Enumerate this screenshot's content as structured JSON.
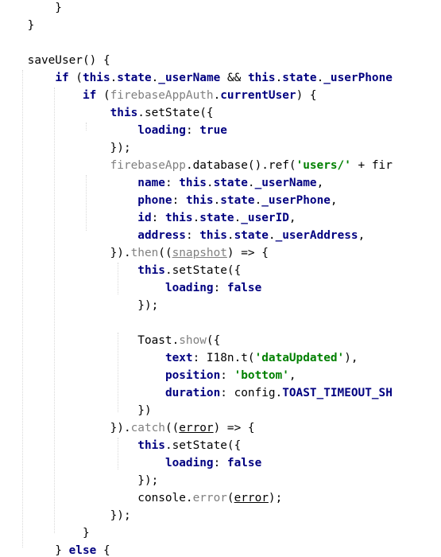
{
  "editor": {
    "language": "javascript",
    "colors": {
      "background": "#ffffff",
      "keyword": "#000080",
      "string": "#008000",
      "property": "#660e7a",
      "unused": "#808080",
      "text": "#000000",
      "indent_guide": "#d8d8d8"
    },
    "lines": [
      [
        {
          "t": "pl",
          "v": "        }"
        }
      ],
      [
        {
          "t": "pl",
          "v": "    }"
        }
      ],
      [
        {
          "t": "pl",
          "v": ""
        }
      ],
      [
        {
          "t": "fn",
          "v": "    saveUser"
        },
        {
          "t": "pl",
          "v": "() {"
        }
      ],
      [
        {
          "t": "pl",
          "v": "        "
        },
        {
          "t": "kw",
          "v": "if"
        },
        {
          "t": "pl",
          "v": " ("
        },
        {
          "t": "kw",
          "v": "this"
        },
        {
          "t": "pl",
          "v": "."
        },
        {
          "t": "kw",
          "v": "state"
        },
        {
          "t": "pl",
          "v": "."
        },
        {
          "t": "kw",
          "v": "_userName"
        },
        {
          "t": "pl",
          "v": " && "
        },
        {
          "t": "kw",
          "v": "this"
        },
        {
          "t": "pl",
          "v": "."
        },
        {
          "t": "kw",
          "v": "state"
        },
        {
          "t": "pl",
          "v": "."
        },
        {
          "t": "kw",
          "v": "_userPhone"
        }
      ],
      [
        {
          "t": "pl",
          "v": "            "
        },
        {
          "t": "kw",
          "v": "if"
        },
        {
          "t": "pl",
          "v": " ("
        },
        {
          "t": "dim",
          "v": "firebaseAppAuth"
        },
        {
          "t": "pl",
          "v": "."
        },
        {
          "t": "kw",
          "v": "currentUser"
        },
        {
          "t": "pl",
          "v": ") {"
        }
      ],
      [
        {
          "t": "pl",
          "v": "                "
        },
        {
          "t": "kw",
          "v": "this"
        },
        {
          "t": "pl",
          "v": ".setState({"
        }
      ],
      [
        {
          "t": "pl",
          "v": "                    "
        },
        {
          "t": "kw",
          "v": "loading"
        },
        {
          "t": "pl",
          "v": ": "
        },
        {
          "t": "kw",
          "v": "true"
        }
      ],
      [
        {
          "t": "pl",
          "v": "                });"
        }
      ],
      [
        {
          "t": "pl",
          "v": "                "
        },
        {
          "t": "dim",
          "v": "firebaseApp"
        },
        {
          "t": "pl",
          "v": ".database().ref("
        },
        {
          "t": "str",
          "v": "'users/'"
        },
        {
          "t": "pl",
          "v": " + fir"
        }
      ],
      [
        {
          "t": "pl",
          "v": "                    "
        },
        {
          "t": "kw",
          "v": "name"
        },
        {
          "t": "pl",
          "v": ": "
        },
        {
          "t": "kw",
          "v": "this"
        },
        {
          "t": "pl",
          "v": "."
        },
        {
          "t": "kw",
          "v": "state"
        },
        {
          "t": "pl",
          "v": "."
        },
        {
          "t": "kw",
          "v": "_userName"
        },
        {
          "t": "pl",
          "v": ","
        }
      ],
      [
        {
          "t": "pl",
          "v": "                    "
        },
        {
          "t": "kw",
          "v": "phone"
        },
        {
          "t": "pl",
          "v": ": "
        },
        {
          "t": "kw",
          "v": "this"
        },
        {
          "t": "pl",
          "v": "."
        },
        {
          "t": "kw",
          "v": "state"
        },
        {
          "t": "pl",
          "v": "."
        },
        {
          "t": "kw",
          "v": "_userPhone"
        },
        {
          "t": "pl",
          "v": ","
        }
      ],
      [
        {
          "t": "pl",
          "v": "                    "
        },
        {
          "t": "kw",
          "v": "id"
        },
        {
          "t": "pl",
          "v": ": "
        },
        {
          "t": "kw",
          "v": "this"
        },
        {
          "t": "pl",
          "v": "."
        },
        {
          "t": "kw",
          "v": "state"
        },
        {
          "t": "pl",
          "v": "."
        },
        {
          "t": "kw",
          "v": "_userID"
        },
        {
          "t": "pl",
          "v": ","
        }
      ],
      [
        {
          "t": "pl",
          "v": "                    "
        },
        {
          "t": "kw",
          "v": "address"
        },
        {
          "t": "pl",
          "v": ": "
        },
        {
          "t": "kw",
          "v": "this"
        },
        {
          "t": "pl",
          "v": "."
        },
        {
          "t": "kw",
          "v": "state"
        },
        {
          "t": "pl",
          "v": "."
        },
        {
          "t": "kw",
          "v": "_userAddress"
        },
        {
          "t": "pl",
          "v": ","
        }
      ],
      [
        {
          "t": "pl",
          "v": "                })."
        },
        {
          "t": "dim",
          "v": "then"
        },
        {
          "t": "pl",
          "v": "(("
        },
        {
          "t": "dim ul",
          "v": "snapshot"
        },
        {
          "t": "pl",
          "v": ") => {"
        }
      ],
      [
        {
          "t": "pl",
          "v": "                    "
        },
        {
          "t": "kw",
          "v": "this"
        },
        {
          "t": "pl",
          "v": ".setState({"
        }
      ],
      [
        {
          "t": "pl",
          "v": "                        "
        },
        {
          "t": "kw",
          "v": "loading"
        },
        {
          "t": "pl",
          "v": ": "
        },
        {
          "t": "kw",
          "v": "false"
        }
      ],
      [
        {
          "t": "pl",
          "v": "                    });"
        }
      ],
      [
        {
          "t": "pl",
          "v": ""
        }
      ],
      [
        {
          "t": "pl",
          "v": "                    Toast."
        },
        {
          "t": "dim",
          "v": "show"
        },
        {
          "t": "pl",
          "v": "({"
        }
      ],
      [
        {
          "t": "pl",
          "v": "                        "
        },
        {
          "t": "kw",
          "v": "text"
        },
        {
          "t": "pl",
          "v": ": I18n.t("
        },
        {
          "t": "str",
          "v": "'dataUpdated'"
        },
        {
          "t": "pl",
          "v": "),"
        }
      ],
      [
        {
          "t": "pl",
          "v": "                        "
        },
        {
          "t": "kw",
          "v": "position"
        },
        {
          "t": "pl",
          "v": ": "
        },
        {
          "t": "str",
          "v": "'bottom'"
        },
        {
          "t": "pl",
          "v": ","
        }
      ],
      [
        {
          "t": "pl",
          "v": "                        "
        },
        {
          "t": "kw",
          "v": "duration"
        },
        {
          "t": "pl",
          "v": ": config."
        },
        {
          "t": "kw",
          "v": "TOAST_TIMEOUT_SH"
        }
      ],
      [
        {
          "t": "pl",
          "v": "                    })"
        }
      ],
      [
        {
          "t": "pl",
          "v": "                })."
        },
        {
          "t": "dim",
          "v": "catch"
        },
        {
          "t": "pl",
          "v": "(("
        },
        {
          "t": "pl ul",
          "v": "error"
        },
        {
          "t": "pl",
          "v": ") => {"
        }
      ],
      [
        {
          "t": "pl",
          "v": "                    "
        },
        {
          "t": "kw",
          "v": "this"
        },
        {
          "t": "pl",
          "v": ".setState({"
        }
      ],
      [
        {
          "t": "pl",
          "v": "                        "
        },
        {
          "t": "kw",
          "v": "loading"
        },
        {
          "t": "pl",
          "v": ": "
        },
        {
          "t": "kw",
          "v": "false"
        }
      ],
      [
        {
          "t": "pl",
          "v": "                    });"
        }
      ],
      [
        {
          "t": "pl",
          "v": "                    console."
        },
        {
          "t": "dim",
          "v": "error"
        },
        {
          "t": "pl",
          "v": "("
        },
        {
          "t": "pl ul",
          "v": "error"
        },
        {
          "t": "pl",
          "v": ");"
        }
      ],
      [
        {
          "t": "pl",
          "v": "                });"
        }
      ],
      [
        {
          "t": "pl",
          "v": "            }"
        }
      ],
      [
        {
          "t": "pl",
          "v": "        } "
        },
        {
          "t": "kw",
          "v": "else"
        },
        {
          "t": "pl",
          "v": " {"
        }
      ]
    ]
  }
}
